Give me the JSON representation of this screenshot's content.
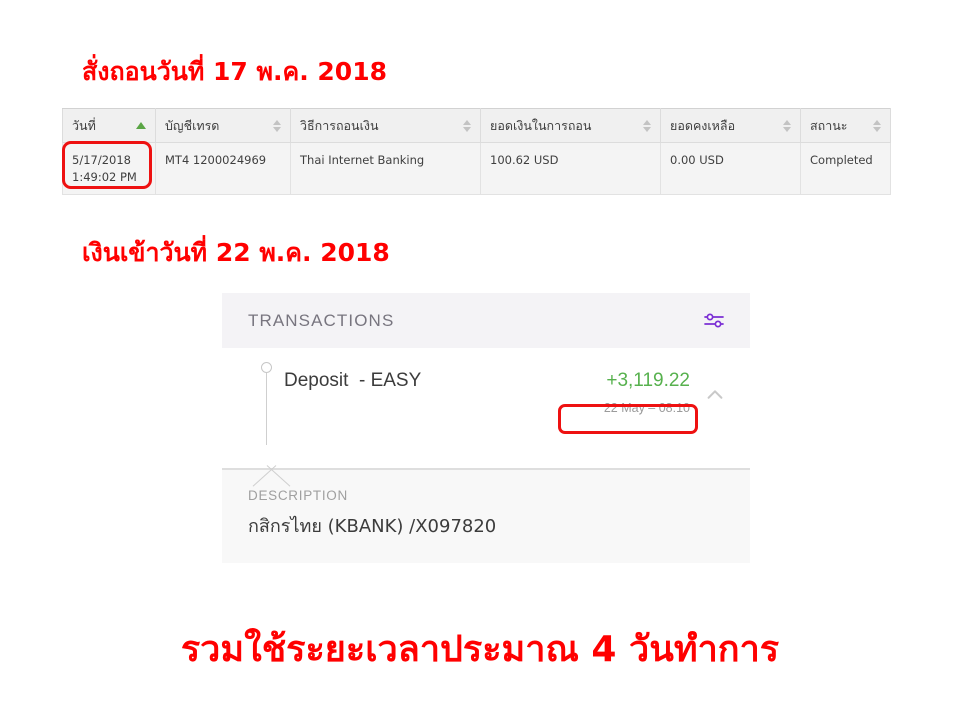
{
  "headlines": {
    "withdraw_request": "สั่งถอนวันที่ 17 พ.ค. 2018",
    "deposit_received": "เงินเข้าวันที่ 22 พ.ค. 2018",
    "summary": "รวมใช้ระยะเวลาประมาณ 4 วันทำการ"
  },
  "withdrawal_table": {
    "columns": [
      {
        "label": "วันที่",
        "sort": "asc"
      },
      {
        "label": "บัญชีเทรด",
        "sort": "none"
      },
      {
        "label": "วิธีการถอนเงิน",
        "sort": "none"
      },
      {
        "label": "ยอดเงินในการถอน",
        "sort": "none"
      },
      {
        "label": "ยอดคงเหลือ",
        "sort": "none"
      },
      {
        "label": "สถานะ",
        "sort": "none"
      }
    ],
    "rows": [
      {
        "date": "5/17/2018",
        "time": "1:49:02 PM",
        "account": "MT4 1200024969",
        "method": "Thai Internet Banking",
        "amount": "100.62 USD",
        "balance": "0.00 USD",
        "status": "Completed"
      }
    ]
  },
  "transactions_card": {
    "title": "TRANSACTIONS",
    "filter_icon": "sliders-icon",
    "transaction": {
      "label": "Deposit  - EASY",
      "amount": "+3,119.22",
      "date": "22 May – 08:10",
      "collapse_icon": "chevron-up-icon"
    },
    "description_label": "DESCRIPTION",
    "description_value": "กสิกรไทย (KBANK) /X097820"
  },
  "colors": {
    "headline_red": "#ff0000",
    "highlight_box_red": "#ee1111",
    "amount_green": "#57b14e",
    "sort_active_green": "#5aa545",
    "filter_icon_purple": "#7b2fd4"
  }
}
